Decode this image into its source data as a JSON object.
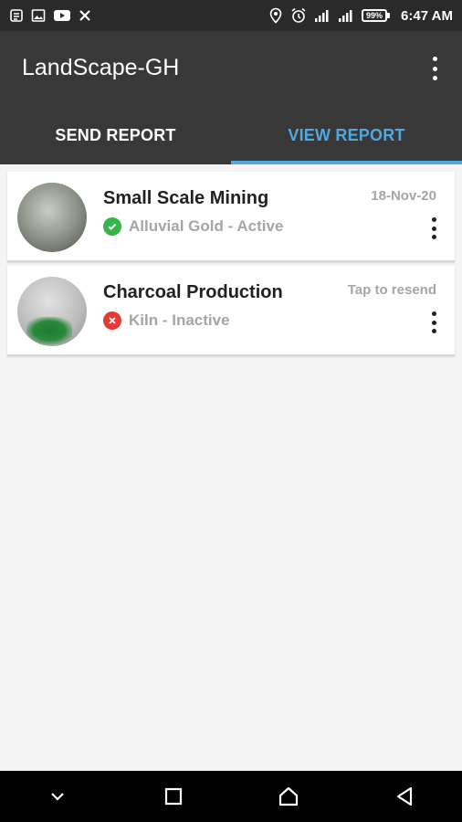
{
  "status_bar": {
    "left_icons": [
      "sim-icon",
      "image-icon",
      "youtube-icon",
      "x-icon"
    ],
    "right_icons": [
      "location-icon",
      "alarm-icon",
      "signal-icon",
      "signal-2-icon"
    ],
    "battery": "99%",
    "time": "6:47 AM"
  },
  "app": {
    "title": "LandScape-GH",
    "menu_icon": "more-vert-icon"
  },
  "tabs": [
    {
      "label": "SEND REPORT",
      "active": false
    },
    {
      "label": "VIEW REPORT",
      "active": true
    }
  ],
  "colors": {
    "accent": "#4fa8df",
    "toolbar": "#383838",
    "status_bar": "#2a2a2a",
    "active_status": "#35b44a",
    "inactive_status": "#e53935"
  },
  "reports": [
    {
      "title": "Small Scale Mining",
      "subtitle": "Alluvial Gold - Active",
      "status": "active",
      "status_icon": "check-circle-icon",
      "meta": "18-Nov-20"
    },
    {
      "title": "Charcoal Production",
      "subtitle": "Kiln - Inactive",
      "status": "inactive",
      "status_icon": "cancel-circle-icon",
      "meta": "Tap to resend"
    }
  ],
  "nav_bar": [
    "nav-collapse-icon",
    "nav-recents-icon",
    "nav-home-icon",
    "nav-back-icon"
  ]
}
